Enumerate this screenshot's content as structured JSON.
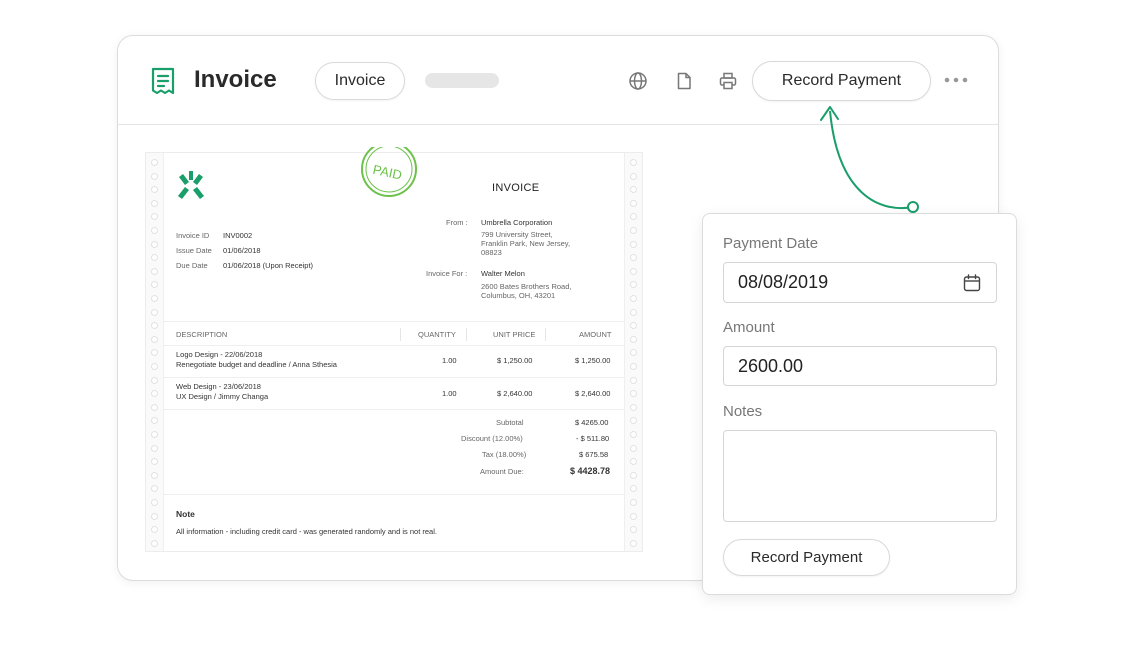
{
  "app": {
    "title": "Invoice",
    "tab_label": "Invoice",
    "record_button": "Record Payment"
  },
  "toolbar_icons": [
    "globe-icon",
    "document-icon",
    "printer-icon",
    "more-icon"
  ],
  "colors": {
    "brand": "#1a9e6a",
    "stamp": "#6cc24a"
  },
  "invoice": {
    "heading": "INVOICE",
    "stamp": "PAID",
    "meta": [
      {
        "label": "Invoice ID",
        "value": "INV0002"
      },
      {
        "label": "Issue Date",
        "value": "01/06/2018"
      },
      {
        "label": "Due Date",
        "value": "01/06/2018 (Upon Receipt)"
      }
    ],
    "from_label": "From :",
    "from_name": "Umbrella Corporation",
    "from_addr1": "799  University Street,",
    "from_addr2": "Franklin Park, New Jersey,",
    "from_addr3": "08823",
    "for_label": "Invoice For :",
    "for_name": "Walter Melon",
    "for_addr1": "2600 Bates Brothers Road,",
    "for_addr2": "Columbus, OH, 43201",
    "columns": [
      "DESCRIPTION",
      "QUANTITY",
      "UNIT PRICE",
      "AMOUNT"
    ],
    "items": [
      {
        "title": "Logo Design - 22/06/2018",
        "sub": "Renegotiate budget and deadline / Anna Sthesia",
        "qty": "1.00",
        "price": "$ 1,250.00",
        "amount": "$ 1,250.00"
      },
      {
        "title": "Web Design - 23/06/2018",
        "sub": "UX Design / Jimmy Changa",
        "qty": "1.00",
        "price": "$ 2,640.00",
        "amount": "$ 2,640.00"
      }
    ],
    "totals": [
      {
        "label": "Subtotal",
        "value": "$ 4265.00"
      },
      {
        "label": "Discount (12.00%)",
        "value": "- $ 511.80"
      },
      {
        "label": "Tax (18.00%)",
        "value": "$ 675.58"
      },
      {
        "label": "Amount Due:",
        "value": "$ 4428.78"
      }
    ],
    "note_title": "Note",
    "note_text": "All information - including credit card - was generated randomly and is not real."
  },
  "payment": {
    "date_label": "Payment Date",
    "date_value": "08/08/2019",
    "amount_label": "Amount",
    "amount_value": "2600.00",
    "notes_label": "Notes",
    "notes_value": "",
    "submit": "Record Payment"
  }
}
